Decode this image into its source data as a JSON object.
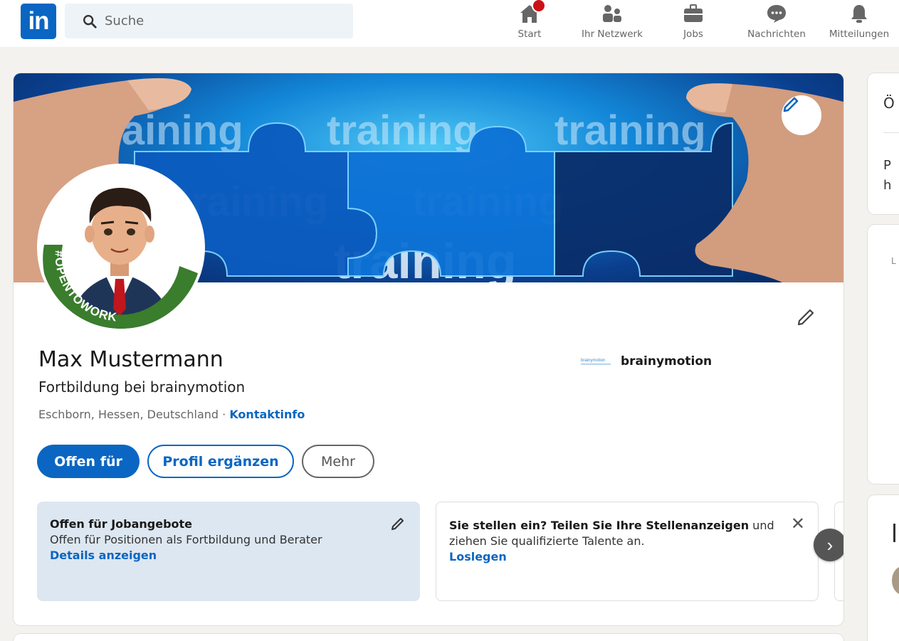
{
  "nav": {
    "search_placeholder": "Suche",
    "items": [
      {
        "label": "Start",
        "icon": "home-icon",
        "has_badge": true
      },
      {
        "label": "Ihr Netzwerk",
        "icon": "network-icon"
      },
      {
        "label": "Jobs",
        "icon": "briefcase-icon"
      },
      {
        "label": "Nachrichten",
        "icon": "messaging-icon"
      },
      {
        "label": "Mitteilungen",
        "icon": "bell-icon"
      }
    ]
  },
  "banner": {
    "words": [
      "training",
      "training",
      "training",
      "training",
      "training",
      "training"
    ]
  },
  "profile": {
    "avatar_frame_text": "#OPENTOWORK",
    "name": "Max Mustermann",
    "headline": "Fortbildung bei brainymotion",
    "location": "Eschborn, Hessen, Deutschland",
    "separator": " · ",
    "contact_link": "Kontaktinfo",
    "company_logo_text": "brainymotion",
    "company": "brainymotion"
  },
  "actions": {
    "primary": "Offen für",
    "secondary": "Profil ergänzen",
    "more": "Mehr"
  },
  "open_to_work": {
    "title": "Offen für Jobangebote",
    "subtitle": "Offen für Positionen als Fortbildung und Berater",
    "link": "Details anzeigen"
  },
  "hiring": {
    "bold": "Sie stellen ein? Teilen Sie Ihre Stellenanzeigen",
    "rest": " und ziehen Sie qualifizierte Talente an.",
    "link": "Loslegen",
    "close": "✕",
    "next": "›"
  },
  "sidebar": {
    "c1": "Ö",
    "c2a": "P",
    "c2b": "h",
    "c3": "L"
  },
  "colors": {
    "brand": "#0a66c2",
    "otw_green": "#3a7d2c",
    "badge_red": "#cc1016"
  }
}
